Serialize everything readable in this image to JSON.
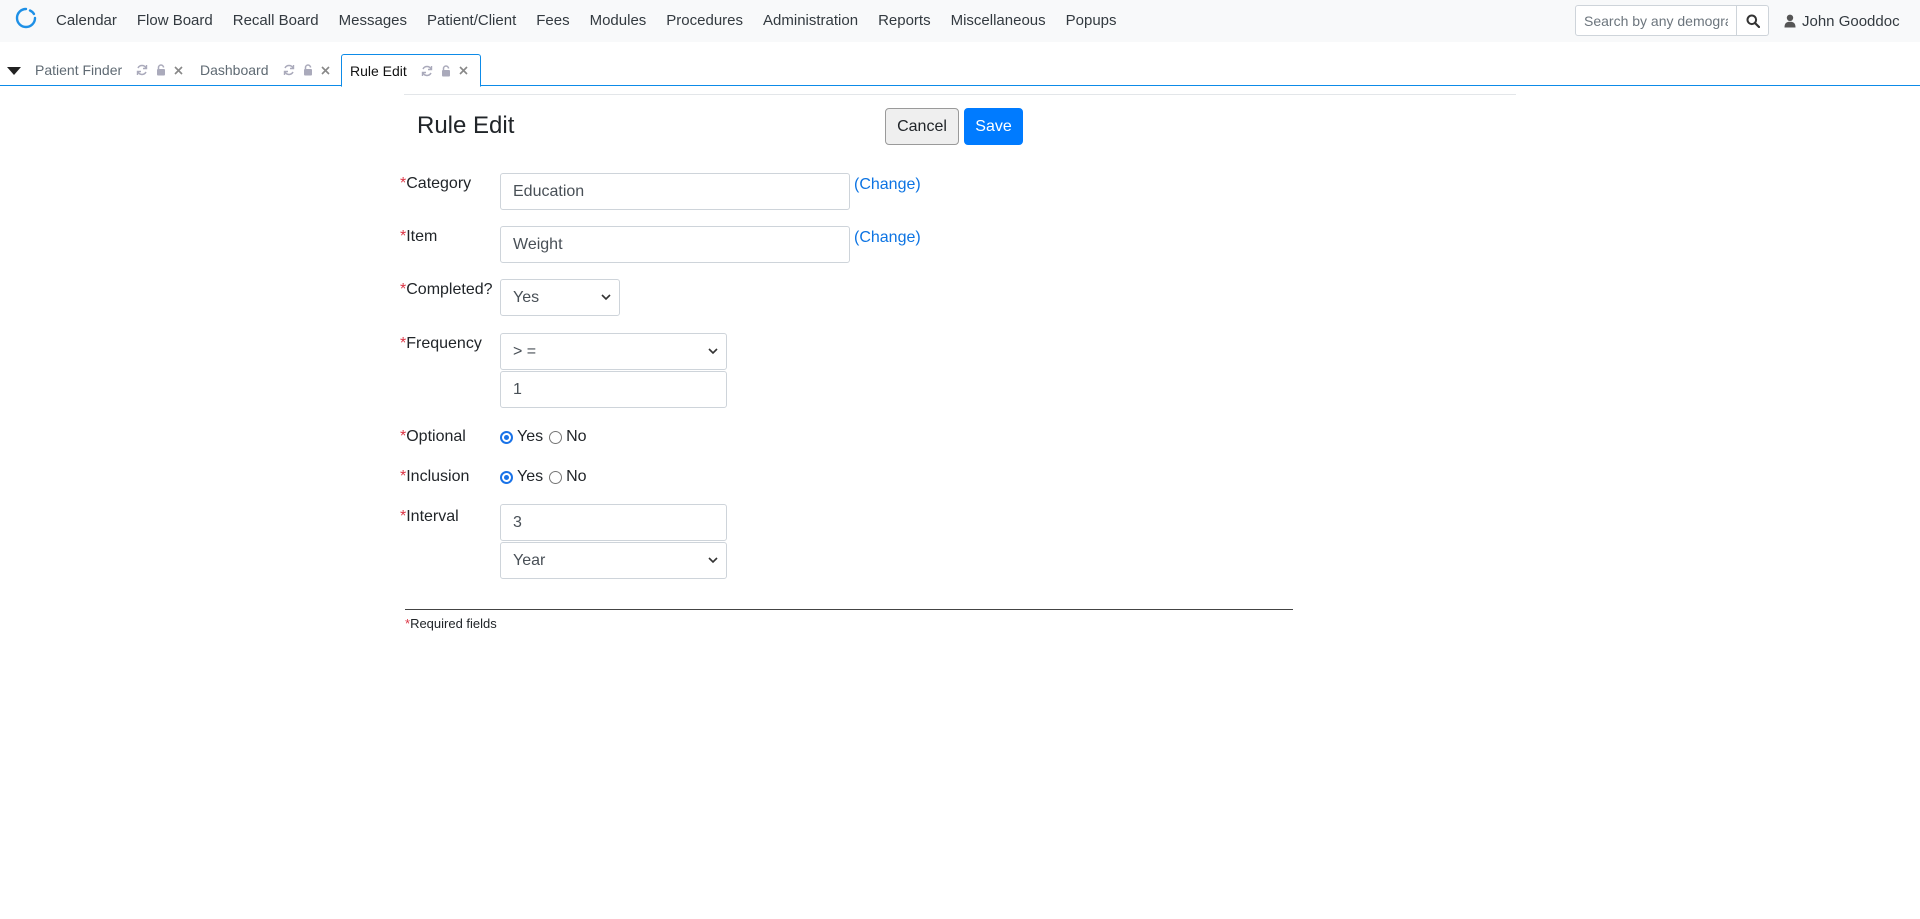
{
  "nav": {
    "menu": [
      "Calendar",
      "Flow Board",
      "Recall Board",
      "Messages",
      "Patient/Client",
      "Fees",
      "Modules",
      "Procedures",
      "Administration",
      "Reports",
      "Miscellaneous",
      "Popups"
    ],
    "search_placeholder": "Search by any demographics",
    "user_name": "John Gooddoc"
  },
  "tabs": [
    {
      "label": "Patient Finder",
      "active": false
    },
    {
      "label": "Dashboard",
      "active": false
    },
    {
      "label": "Rule Edit",
      "active": true
    }
  ],
  "form": {
    "title": "Rule Edit",
    "cancel_label": "Cancel",
    "save_label": "Save",
    "required_mark": "*",
    "category": {
      "label": "Category",
      "value": "Education",
      "change_label": "(Change)"
    },
    "item": {
      "label": "Item",
      "value": "Weight",
      "change_label": "(Change)"
    },
    "completed": {
      "label": "Completed?",
      "value": "Yes"
    },
    "frequency": {
      "label": "Frequency",
      "operator": "> =",
      "value": "1"
    },
    "optional": {
      "label": "Optional",
      "yes": "Yes",
      "no": "No",
      "selected": "Yes"
    },
    "inclusion": {
      "label": "Inclusion",
      "yes": "Yes",
      "no": "No",
      "selected": "Yes"
    },
    "interval": {
      "label": "Interval",
      "value": "3",
      "unit": "Year"
    },
    "required_note": "Required fields"
  },
  "colors": {
    "accent": "#007bff",
    "required": "#dc3545",
    "link": "#0d74e3"
  }
}
